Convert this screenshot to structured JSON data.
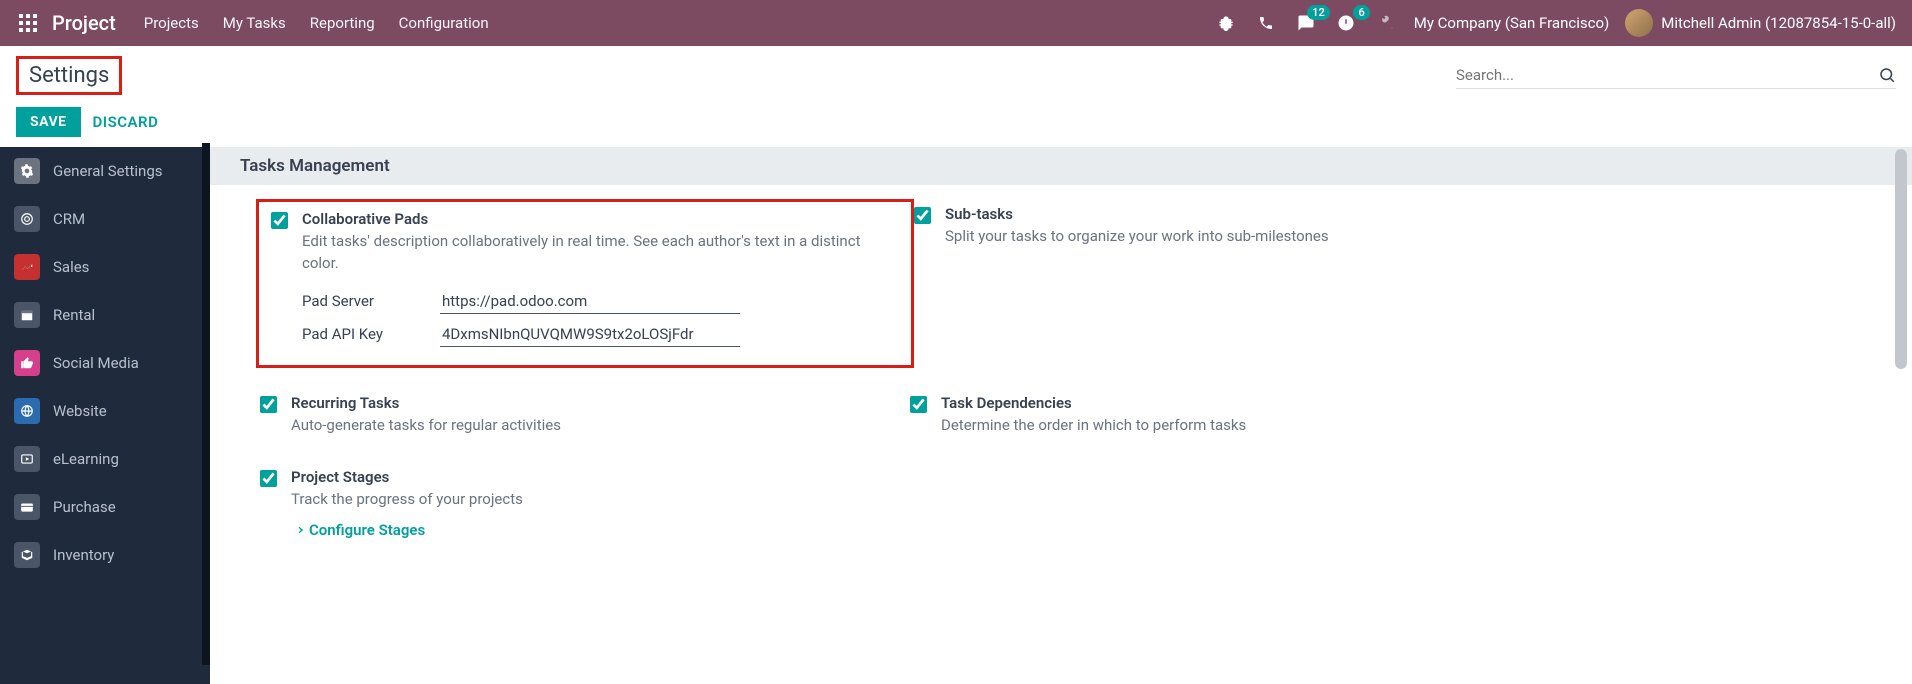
{
  "navbar": {
    "brand": "Project",
    "links": [
      "Projects",
      "My Tasks",
      "Reporting",
      "Configuration"
    ],
    "messages_badge": "12",
    "activities_badge": "6",
    "company": "My Company (San Francisco)",
    "user": "Mitchell Admin (12087854-15-0-all)"
  },
  "breadcrumb": {
    "title": "Settings"
  },
  "buttons": {
    "save": "SAVE",
    "discard": "DISCARD"
  },
  "search": {
    "placeholder": "Search..."
  },
  "sidebar": {
    "items": [
      {
        "label": "General Settings",
        "icon": "gear"
      },
      {
        "label": "CRM",
        "icon": "target"
      },
      {
        "label": "Sales",
        "icon": "chart"
      },
      {
        "label": "Rental",
        "icon": "calendar"
      },
      {
        "label": "Social Media",
        "icon": "thumbs-up"
      },
      {
        "label": "Website",
        "icon": "globe"
      },
      {
        "label": "eLearning",
        "icon": "play"
      },
      {
        "label": "Purchase",
        "icon": "card"
      },
      {
        "label": "Inventory",
        "icon": "box"
      }
    ]
  },
  "section": {
    "title": "Tasks Management"
  },
  "settings": {
    "pads": {
      "title": "Collaborative Pads",
      "desc": "Edit tasks' description collaboratively in real time. See each author's text in a distinct color.",
      "server_label": "Pad Server",
      "server_value": "https://pad.odoo.com",
      "api_label": "Pad API Key",
      "api_value": "4DxmsNIbnQUVQMW9S9tx2oLOSjFdr"
    },
    "subtasks": {
      "title": "Sub-tasks",
      "desc": "Split your tasks to organize your work into sub-milestones"
    },
    "recurring": {
      "title": "Recurring Tasks",
      "desc": "Auto-generate tasks for regular activities"
    },
    "dependencies": {
      "title": "Task Dependencies",
      "desc": "Determine the order in which to perform tasks"
    },
    "stages": {
      "title": "Project Stages",
      "desc": "Track the progress of your projects",
      "configure": "Configure Stages"
    }
  }
}
